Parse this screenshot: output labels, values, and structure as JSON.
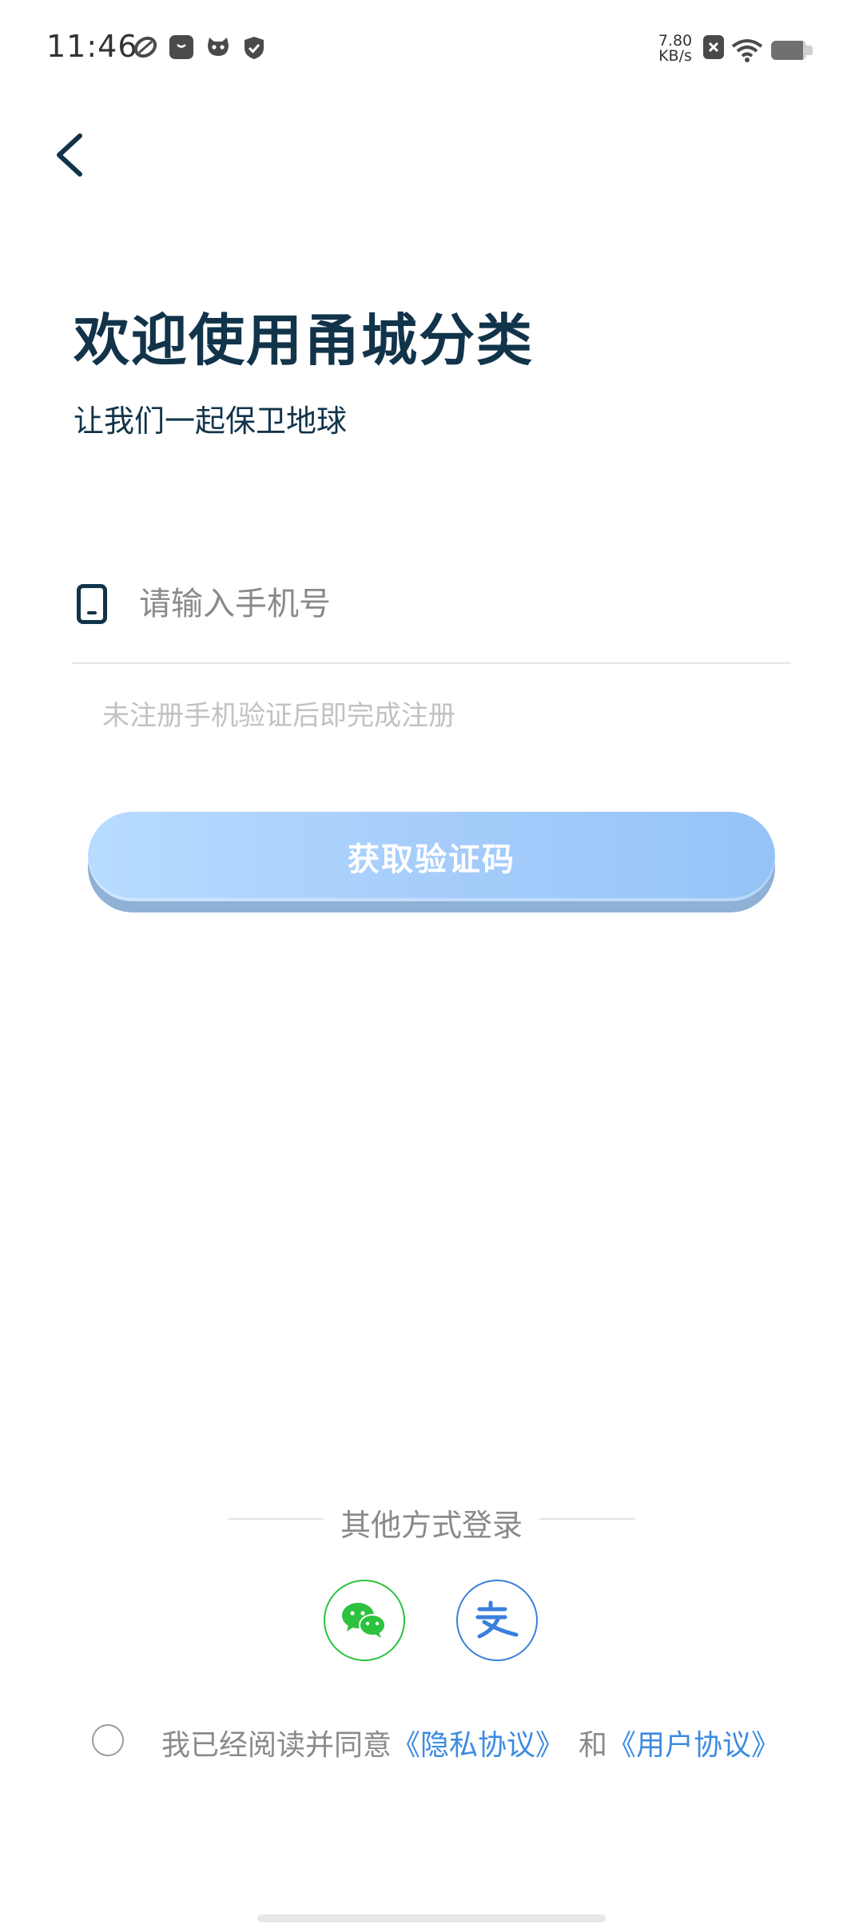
{
  "status_bar": {
    "time": "11:46",
    "net_speed_value": "7.80",
    "net_speed_unit": "KB/s",
    "icons": [
      "leaf-icon",
      "bag-icon",
      "cat-icon",
      "shield-icon",
      "close-box-icon",
      "wifi-icon",
      "battery-icon"
    ]
  },
  "nav": {
    "back_icon": "chevron-left-icon"
  },
  "header": {
    "title": "欢迎使用甬城分类",
    "subtitle": "让我们一起保卫地球"
  },
  "phone_field": {
    "icon": "phone-icon",
    "placeholder": "请输入手机号",
    "value": "",
    "hint": "未注册手机验证后即完成注册"
  },
  "get_code_button": {
    "label": "获取验证码"
  },
  "other_login": {
    "label": "其他方式登录",
    "methods": [
      {
        "name": "wechat",
        "icon": "wechat-icon"
      },
      {
        "name": "alipay",
        "icon": "alipay-icon"
      }
    ]
  },
  "agreement": {
    "checked": false,
    "prefix": "我已经阅读并同意",
    "privacy_link": "《隐私协议》",
    "conjunction": "和",
    "user_link": "《用户协议》"
  },
  "colors": {
    "primary_text": "#12344a",
    "button_gradient_start": "#b7dcff",
    "button_gradient_end": "#95c3f7",
    "link": "#3d8be0",
    "wechat": "#2dc23d",
    "alipay": "#3a7fdc"
  }
}
